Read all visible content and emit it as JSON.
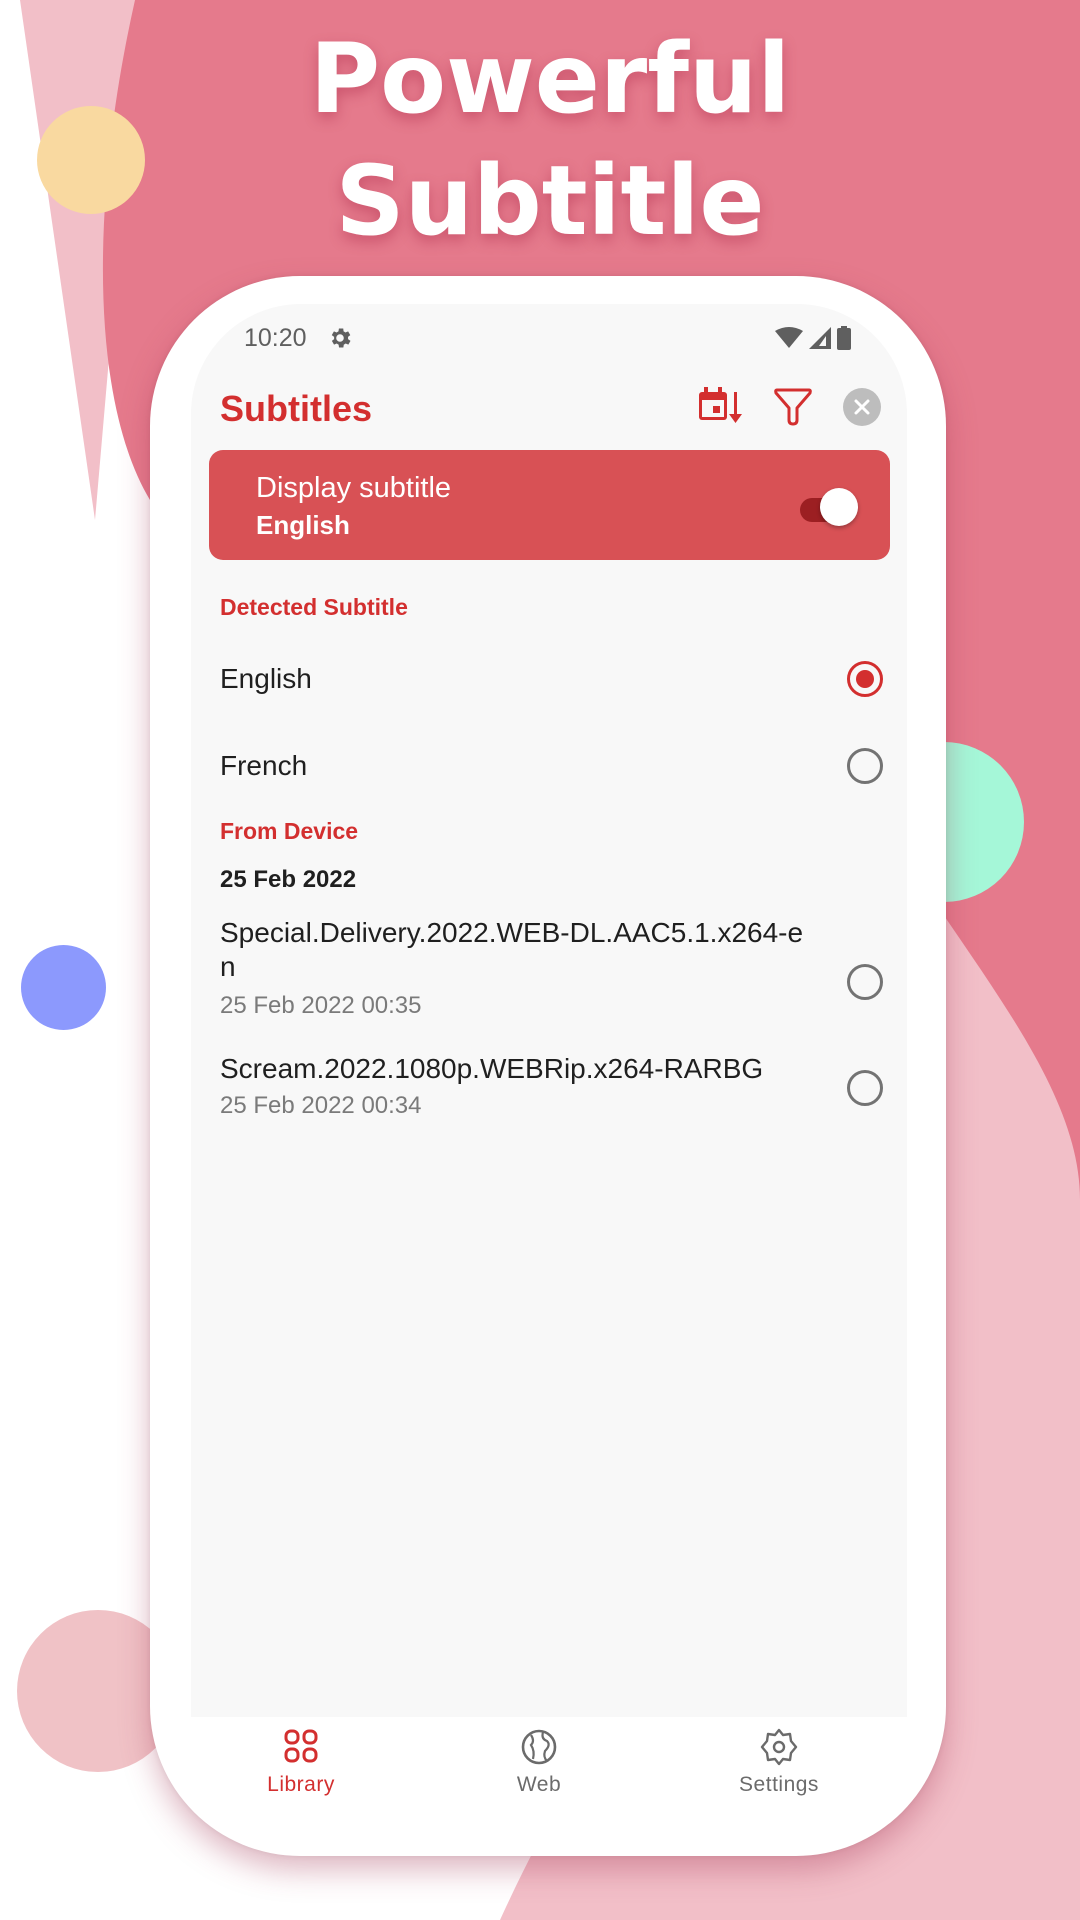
{
  "promo": {
    "headline_line1": "Powerful",
    "headline_line2": "Subtitle"
  },
  "colors": {
    "accent": "#d32f2f",
    "card": "#d85155",
    "background_pink": "#e57a8c",
    "background_light_pink": "#f2bfc8",
    "deco_yellow": "#f9d9a0",
    "deco_mint": "#a5f7d8",
    "deco_blue": "#8c99fd"
  },
  "status_bar": {
    "time": "10:20",
    "icons": [
      "settings-icon",
      "wifi-icon",
      "signal-icon",
      "battery-icon"
    ]
  },
  "app_bar": {
    "title": "Subtitles",
    "actions": [
      "sort-by-date-icon",
      "filter-icon",
      "close-icon"
    ]
  },
  "display_card": {
    "label": "Display subtitle",
    "value": "English",
    "toggle_on": true
  },
  "detected": {
    "header": "Detected Subtitle",
    "options": [
      {
        "label": "English",
        "selected": true
      },
      {
        "label": "French",
        "selected": false
      }
    ]
  },
  "device": {
    "header": "From Device",
    "date_group": "25 Feb 2022",
    "files": [
      {
        "name": "Special.Delivery.2022.WEB-DL.AAC5.1.x264-en",
        "date": "25 Feb 2022 00:35",
        "selected": false
      },
      {
        "name": "Scream.2022.1080p.WEBRip.x264-RARBG",
        "date": "25 Feb 2022 00:34",
        "selected": false
      }
    ]
  },
  "bottom_nav": {
    "items": [
      {
        "label": "Library",
        "icon": "library-grid-icon",
        "active": true
      },
      {
        "label": "Web",
        "icon": "globe-icon",
        "active": false
      },
      {
        "label": "Settings",
        "icon": "settings-icon",
        "active": false
      }
    ]
  }
}
